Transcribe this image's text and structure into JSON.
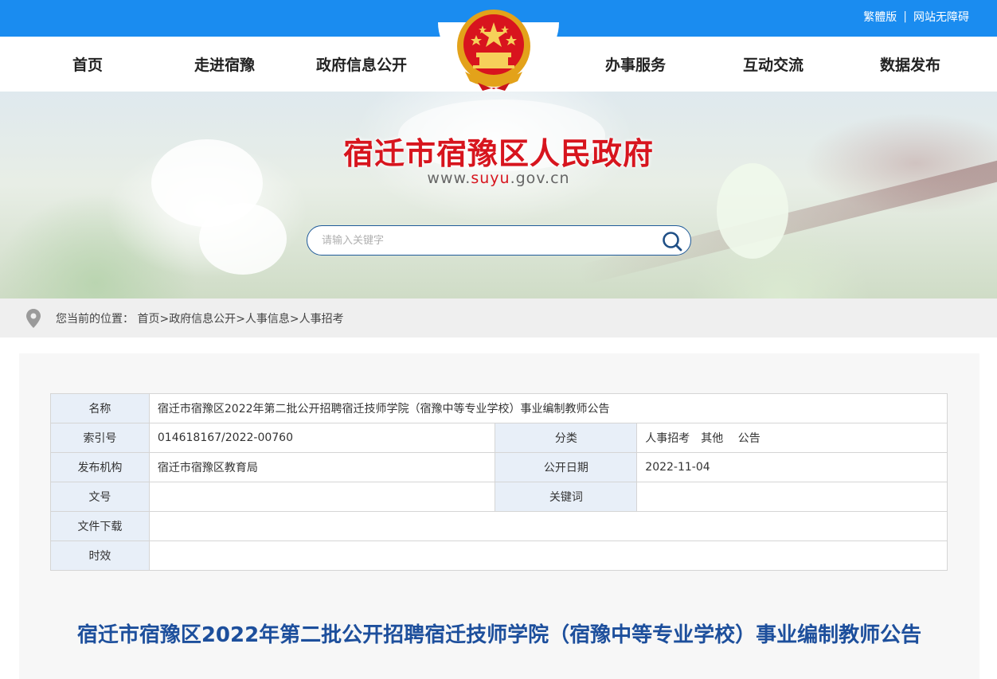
{
  "topbar": {
    "traditional": "繁體版",
    "separator": "|",
    "accessibility": "网站无障碍"
  },
  "nav": {
    "items": [
      "首页",
      "走进宿豫",
      "政府信息公开",
      "办事服务",
      "互动交流",
      "数据发布"
    ]
  },
  "banner": {
    "title": "宿迁市宿豫区人民政府",
    "url_prefix": "www.",
    "url_highlight": "suyu",
    "url_suffix": ".gov.cn",
    "search_placeholder": "请输入关键字"
  },
  "breadcrumb": {
    "label": "您当前的位置：",
    "items": [
      "首页",
      "政府信息公开",
      "人事信息",
      "人事招考"
    ],
    "separator": ">"
  },
  "meta": {
    "name_label": "名称",
    "name_value": "宿迁市宿豫区2022年第二批公开招聘宿迁技师学院（宿豫中等专业学校）事业编制教师公告",
    "index_label": "索引号",
    "index_value": "014618167/2022-00760",
    "category_label": "分类",
    "category_value": "人事招考　其他　 公告",
    "publisher_label": "发布机构",
    "publisher_value": "宿迁市宿豫区教育局",
    "date_label": "公开日期",
    "date_value": "2022-11-04",
    "docno_label": "文号",
    "docno_value": "",
    "keyword_label": "关键词",
    "keyword_value": "",
    "download_label": "文件下载",
    "download_value": "",
    "validity_label": "时效",
    "validity_value": ""
  },
  "document": {
    "title": "宿迁市宿豫区2022年第二批公开招聘宿迁技师学院（宿豫中等专业学校）事业编制教师公告"
  },
  "colors": {
    "topbar": "#1a8cf0",
    "title_red": "#d7151e",
    "doc_title_blue": "#1d4f9c",
    "label_bg": "#e8eff8"
  }
}
